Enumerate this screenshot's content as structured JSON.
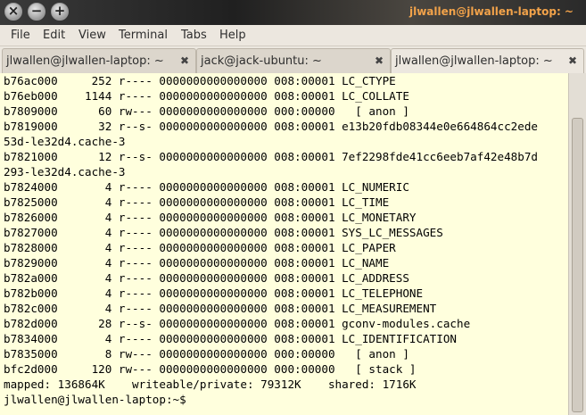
{
  "window": {
    "title": "jlwallen@jlwallen-laptop: ~",
    "buttons": [
      "close",
      "minimize",
      "maximize"
    ]
  },
  "menu": [
    "File",
    "Edit",
    "View",
    "Terminal",
    "Tabs",
    "Help"
  ],
  "tabs": [
    {
      "label": "jlwallen@jlwallen-laptop: ~",
      "active": false
    },
    {
      "label": "jack@jack-ubuntu: ~",
      "active": false
    },
    {
      "label": "jlwallen@jlwallen-laptop: ~",
      "active": true
    }
  ],
  "terminal": {
    "lines": [
      "b76ac000     252 r---- 0000000000000000 008:00001 LC_CTYPE",
      "b76eb000    1144 r---- 0000000000000000 008:00001 LC_COLLATE",
      "b7809000      60 rw--- 0000000000000000 000:00000   [ anon ]",
      "b7819000      32 r--s- 0000000000000000 008:00001 e13b20fdb08344e0e664864cc2ede",
      "53d-le32d4.cache-3",
      "b7821000      12 r--s- 0000000000000000 008:00001 7ef2298fde41cc6eeb7af42e48b7d",
      "293-le32d4.cache-3",
      "b7824000       4 r---- 0000000000000000 008:00001 LC_NUMERIC",
      "b7825000       4 r---- 0000000000000000 008:00001 LC_TIME",
      "b7826000       4 r---- 0000000000000000 008:00001 LC_MONETARY",
      "b7827000       4 r---- 0000000000000000 008:00001 SYS_LC_MESSAGES",
      "b7828000       4 r---- 0000000000000000 008:00001 LC_PAPER",
      "b7829000       4 r---- 0000000000000000 008:00001 LC_NAME",
      "b782a000       4 r---- 0000000000000000 008:00001 LC_ADDRESS",
      "b782b000       4 r---- 0000000000000000 008:00001 LC_TELEPHONE",
      "b782c000       4 r---- 0000000000000000 008:00001 LC_MEASUREMENT",
      "b782d000      28 r--s- 0000000000000000 008:00001 gconv-modules.cache",
      "b7834000       4 r---- 0000000000000000 008:00001 LC_IDENTIFICATION",
      "b7835000       8 rw--- 0000000000000000 000:00000   [ anon ]",
      "bfc2d000     120 rw--- 0000000000000000 000:00000   [ stack ]",
      "mapped: 136864K    writeable/private: 79312K    shared: 1716K",
      "jlwallen@jlwallen-laptop:~$ "
    ]
  },
  "colors": {
    "terminal_bg": "#ffffdd",
    "title_text": "#f3a34a"
  }
}
